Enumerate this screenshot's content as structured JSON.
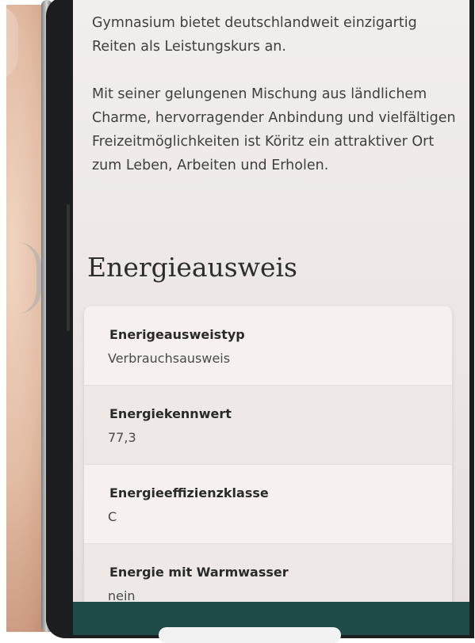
{
  "intro": {
    "line1": "Gymnasium bietet deutschlandweit einzigartig Reiten als Leistungskurs an.",
    "paragraph2": "Mit seiner gelungenen Mischung aus ländlichem Charme, hervorragender Anbindung und vielfältigen Freizeitmöglichkeiten ist Köritz ein attraktiver Ort zum Leben, Arbeiten und Erholen."
  },
  "section": {
    "title": "Energieausweis"
  },
  "energy": {
    "rows": [
      {
        "label": "Enerigeausweistyp",
        "value": "Verbrauchsausweis"
      },
      {
        "label": "Energiekennwert",
        "value": "77,3"
      },
      {
        "label": "Energieeffizienzklasse",
        "value": "C"
      },
      {
        "label": "Energie mit Warmwasser",
        "value": "nein"
      }
    ]
  }
}
